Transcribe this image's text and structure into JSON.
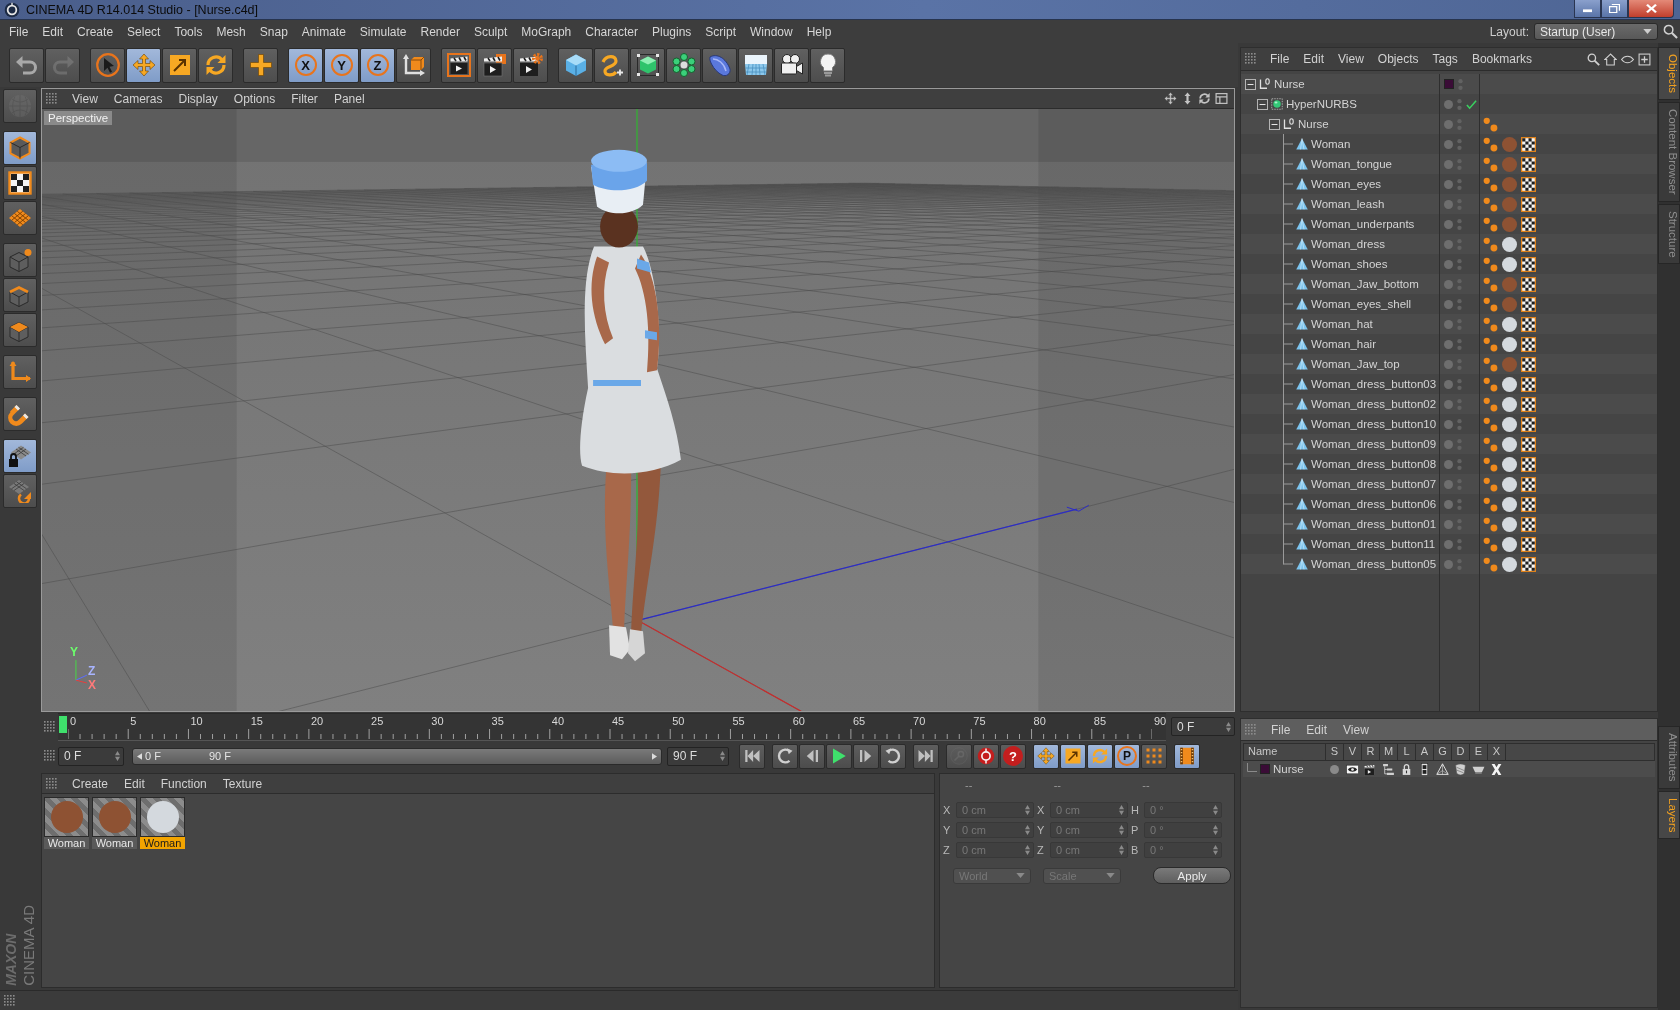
{
  "window": {
    "title": "CINEMA 4D R14.014 Studio - [Nurse.c4d]"
  },
  "menu": [
    "File",
    "Edit",
    "Create",
    "Select",
    "Tools",
    "Mesh",
    "Snap",
    "Animate",
    "Simulate",
    "Render",
    "Sculpt",
    "MoGraph",
    "Character",
    "Plugins",
    "Script",
    "Window",
    "Help"
  ],
  "layout": {
    "label": "Layout:",
    "value": "Startup (User)"
  },
  "toolbar": [
    [
      {
        "kind": "undo",
        "selected": false,
        "disabled": false
      },
      {
        "kind": "redo",
        "selected": false,
        "disabled": true
      }
    ],
    [
      {
        "kind": "live_select",
        "selected": false,
        "disabled": false
      },
      {
        "kind": "move",
        "selected": true,
        "disabled": false
      },
      {
        "kind": "scale",
        "selected": false,
        "disabled": false
      },
      {
        "kind": "rotate",
        "selected": false,
        "disabled": false
      }
    ],
    [
      {
        "kind": "add",
        "selected": false,
        "disabled": false
      }
    ],
    [
      {
        "kind": "axis_lock",
        "label": "X",
        "selected": true,
        "disabled": false
      },
      {
        "kind": "axis_lock",
        "label": "Y",
        "selected": true,
        "disabled": false
      },
      {
        "kind": "axis_lock",
        "label": "Z",
        "selected": true,
        "disabled": false
      },
      {
        "kind": "coords",
        "selected": false,
        "disabled": false
      }
    ],
    [
      {
        "kind": "render_view",
        "selected": false,
        "disabled": false
      },
      {
        "kind": "render_picture",
        "selected": false,
        "disabled": false
      },
      {
        "kind": "render_settings",
        "selected": false,
        "disabled": false
      }
    ],
    [
      {
        "kind": "cube",
        "selected": false,
        "disabled": false
      },
      {
        "kind": "spline",
        "selected": false,
        "disabled": false
      },
      {
        "kind": "nurbs",
        "selected": false,
        "disabled": false
      },
      {
        "kind": "array",
        "selected": false,
        "disabled": false
      },
      {
        "kind": "deformer",
        "selected": false,
        "disabled": false
      },
      {
        "kind": "floor",
        "selected": false,
        "disabled": false
      },
      {
        "kind": "camera",
        "selected": false,
        "disabled": false
      },
      {
        "kind": "light",
        "selected": false,
        "disabled": false
      }
    ]
  ],
  "modes": [
    [
      {
        "kind": "editable",
        "selected": false,
        "disabled": true
      }
    ],
    [
      {
        "kind": "model",
        "selected": true,
        "disabled": false
      },
      {
        "kind": "texture",
        "selected": false,
        "disabled": false
      },
      {
        "kind": "workplane",
        "selected": false,
        "disabled": false
      }
    ],
    [
      {
        "kind": "points",
        "selected": false,
        "disabled": false
      },
      {
        "kind": "edges",
        "selected": false,
        "disabled": false
      },
      {
        "kind": "polygons",
        "selected": false,
        "disabled": false
      }
    ],
    [
      {
        "kind": "axis",
        "selected": false,
        "disabled": false
      }
    ],
    [
      {
        "kind": "snap",
        "selected": false,
        "disabled": false
      }
    ],
    [
      {
        "kind": "lock",
        "selected": true,
        "disabled": false
      },
      {
        "kind": "workplane_snap",
        "selected": false,
        "disabled": false
      }
    ]
  ],
  "logo": {
    "brand": "MAXON",
    "product": "CINEMA 4D"
  },
  "viewport": {
    "menu": [
      "View",
      "Cameras",
      "Display",
      "Options",
      "Filter",
      "Panel"
    ],
    "camera": "Perspective",
    "gizmo": [
      {
        "kind": "y",
        "label": "Y"
      },
      {
        "kind": "z",
        "label": "Z"
      },
      {
        "kind": "x",
        "label": "X"
      }
    ]
  },
  "timeline": {
    "ticks": [
      "0",
      "5",
      "10",
      "15",
      "20",
      "25",
      "30",
      "35",
      "40",
      "45",
      "50",
      "55",
      "60",
      "65",
      "70",
      "75",
      "80",
      "85",
      "90"
    ],
    "level": 0,
    "frame": "0 F"
  },
  "transport": {
    "start": "0 F",
    "range": {
      "start": "0 F",
      "end": "90 F"
    },
    "end": "90 F",
    "playback": [
      [
        {
          "kind": "to_start"
        }
      ],
      [
        {
          "kind": "prev_key"
        },
        {
          "kind": "prev_frame"
        },
        {
          "kind": "play"
        },
        {
          "kind": "next_frame"
        },
        {
          "kind": "next_key"
        }
      ],
      [
        {
          "kind": "to_end"
        }
      ]
    ],
    "record": [
      {
        "kind": "key",
        "disabled": true
      },
      {
        "kind": "record",
        "disabled": false
      },
      {
        "kind": "key_help",
        "label": "?",
        "disabled": false
      }
    ],
    "keys": [
      {
        "kind": "move",
        "selected": true
      },
      {
        "kind": "scale",
        "selected": true
      },
      {
        "kind": "rotate",
        "selected": true
      },
      {
        "kind": "param",
        "label": "P",
        "selected": true
      },
      {
        "kind": "dots",
        "selected": false
      }
    ],
    "timeline_view": {
      "selected": true
    }
  },
  "materials": {
    "menu": [
      "Create",
      "Edit",
      "Function",
      "Texture"
    ],
    "items": [
      {
        "name": "Woman",
        "color": "#8e5233",
        "selected": false
      },
      {
        "name": "Woman",
        "color": "#8e5233",
        "selected": false
      },
      {
        "name": "Woman",
        "color": "#d4d9de",
        "selected": true
      }
    ]
  },
  "coordinates": {
    "disabled": true,
    "headers": [
      "--",
      "--",
      "--"
    ],
    "rows": [
      {
        "axis": "X",
        "position": "0 cm",
        "size_axis": "X",
        "size": "0 cm",
        "angle_axis": "H",
        "rotation": "0 °"
      },
      {
        "axis": "Y",
        "position": "0 cm",
        "size_axis": "Y",
        "size": "0 cm",
        "angle_axis": "P",
        "rotation": "0 °"
      },
      {
        "axis": "Z",
        "position": "0 cm",
        "size_axis": "Z",
        "size": "0 cm",
        "angle_axis": "B",
        "rotation": "0 °"
      }
    ],
    "system": "World",
    "mode": "Scale",
    "apply": "Apply"
  },
  "objects": {
    "menu": [
      "File",
      "Edit",
      "View",
      "Objects",
      "Tags",
      "Bookmarks"
    ],
    "tree": [
      {
        "name": "Nurse",
        "kind": "null",
        "expanded": true,
        "color": "#3a0c36",
        "children": [
          {
            "name": "HyperNURBS",
            "kind": "hypernurbs",
            "expanded": true,
            "enabled": true,
            "children": [
              {
                "name": "Nurse",
                "kind": "null",
                "expanded": true,
                "tags": [
                  {
                    "kind": "phong"
                  }
                ],
                "children": [
                  {
                    "name": "Woman",
                    "kind": "polygon",
                    "tags": [
                      {
                        "kind": "phong"
                      },
                      {
                        "kind": "material",
                        "color": "#8e5233"
                      },
                      {
                        "kind": "uvw"
                      }
                    ]
                  },
                  {
                    "name": "Woman_tongue",
                    "kind": "polygon",
                    "tags": [
                      {
                        "kind": "phong"
                      },
                      {
                        "kind": "material",
                        "color": "#8e5233"
                      },
                      {
                        "kind": "uvw"
                      }
                    ]
                  },
                  {
                    "name": "Woman_eyes",
                    "kind": "polygon",
                    "tags": [
                      {
                        "kind": "phong"
                      },
                      {
                        "kind": "material",
                        "color": "#8e5233"
                      },
                      {
                        "kind": "uvw"
                      }
                    ]
                  },
                  {
                    "name": "Woman_leash",
                    "kind": "polygon",
                    "tags": [
                      {
                        "kind": "phong"
                      },
                      {
                        "kind": "material",
                        "color": "#8e5233"
                      },
                      {
                        "kind": "uvw"
                      }
                    ]
                  },
                  {
                    "name": "Woman_underpants",
                    "kind": "polygon",
                    "tags": [
                      {
                        "kind": "phong"
                      },
                      {
                        "kind": "material",
                        "color": "#8e5233"
                      },
                      {
                        "kind": "uvw"
                      }
                    ]
                  },
                  {
                    "name": "Woman_dress",
                    "kind": "polygon",
                    "tags": [
                      {
                        "kind": "phong"
                      },
                      {
                        "kind": "material",
                        "color": "#d4d9de"
                      },
                      {
                        "kind": "uvw"
                      }
                    ]
                  },
                  {
                    "name": "Woman_shoes",
                    "kind": "polygon",
                    "tags": [
                      {
                        "kind": "phong"
                      },
                      {
                        "kind": "material",
                        "color": "#d4d9de"
                      },
                      {
                        "kind": "uvw"
                      }
                    ]
                  },
                  {
                    "name": "Woman_Jaw_bottom",
                    "kind": "polygon",
                    "tags": [
                      {
                        "kind": "phong"
                      },
                      {
                        "kind": "material",
                        "color": "#8e5233"
                      },
                      {
                        "kind": "uvw"
                      }
                    ]
                  },
                  {
                    "name": "Woman_eyes_shell",
                    "kind": "polygon",
                    "tags": [
                      {
                        "kind": "phong"
                      },
                      {
                        "kind": "material",
                        "color": "#8e5233"
                      },
                      {
                        "kind": "uvw"
                      }
                    ]
                  },
                  {
                    "name": "Woman_hat",
                    "kind": "polygon",
                    "tags": [
                      {
                        "kind": "phong"
                      },
                      {
                        "kind": "material",
                        "color": "#d4d9de"
                      },
                      {
                        "kind": "uvw"
                      }
                    ]
                  },
                  {
                    "name": "Woman_hair",
                    "kind": "polygon",
                    "tags": [
                      {
                        "kind": "phong"
                      },
                      {
                        "kind": "material",
                        "color": "#d4d9de"
                      },
                      {
                        "kind": "uvw"
                      }
                    ]
                  },
                  {
                    "name": "Woman_Jaw_top",
                    "kind": "polygon",
                    "tags": [
                      {
                        "kind": "phong"
                      },
                      {
                        "kind": "material",
                        "color": "#8e5233"
                      },
                      {
                        "kind": "uvw"
                      }
                    ]
                  },
                  {
                    "name": "Woman_dress_button03",
                    "kind": "polygon",
                    "tags": [
                      {
                        "kind": "phong"
                      },
                      {
                        "kind": "material",
                        "color": "#d4d9de"
                      },
                      {
                        "kind": "uvw"
                      }
                    ]
                  },
                  {
                    "name": "Woman_dress_button02",
                    "kind": "polygon",
                    "tags": [
                      {
                        "kind": "phong"
                      },
                      {
                        "kind": "material",
                        "color": "#d4d9de"
                      },
                      {
                        "kind": "uvw"
                      }
                    ]
                  },
                  {
                    "name": "Woman_dress_button10",
                    "kind": "polygon",
                    "tags": [
                      {
                        "kind": "phong"
                      },
                      {
                        "kind": "material",
                        "color": "#d4d9de"
                      },
                      {
                        "kind": "uvw"
                      }
                    ]
                  },
                  {
                    "name": "Woman_dress_button09",
                    "kind": "polygon",
                    "tags": [
                      {
                        "kind": "phong"
                      },
                      {
                        "kind": "material",
                        "color": "#d4d9de"
                      },
                      {
                        "kind": "uvw"
                      }
                    ]
                  },
                  {
                    "name": "Woman_dress_button08",
                    "kind": "polygon",
                    "tags": [
                      {
                        "kind": "phong"
                      },
                      {
                        "kind": "material",
                        "color": "#d4d9de"
                      },
                      {
                        "kind": "uvw"
                      }
                    ]
                  },
                  {
                    "name": "Woman_dress_button07",
                    "kind": "polygon",
                    "tags": [
                      {
                        "kind": "phong"
                      },
                      {
                        "kind": "material",
                        "color": "#d4d9de"
                      },
                      {
                        "kind": "uvw"
                      }
                    ]
                  },
                  {
                    "name": "Woman_dress_button06",
                    "kind": "polygon",
                    "tags": [
                      {
                        "kind": "phong"
                      },
                      {
                        "kind": "material",
                        "color": "#d4d9de"
                      },
                      {
                        "kind": "uvw"
                      }
                    ]
                  },
                  {
                    "name": "Woman_dress_button01",
                    "kind": "polygon",
                    "tags": [
                      {
                        "kind": "phong"
                      },
                      {
                        "kind": "material",
                        "color": "#d4d9de"
                      },
                      {
                        "kind": "uvw"
                      }
                    ]
                  },
                  {
                    "name": "Woman_dress_button11",
                    "kind": "polygon",
                    "tags": [
                      {
                        "kind": "phong"
                      },
                      {
                        "kind": "material",
                        "color": "#d4d9de"
                      },
                      {
                        "kind": "uvw"
                      }
                    ]
                  },
                  {
                    "name": "Woman_dress_button05",
                    "kind": "polygon",
                    "tags": [
                      {
                        "kind": "phong"
                      },
                      {
                        "kind": "material",
                        "color": "#d4d9de"
                      },
                      {
                        "kind": "uvw"
                      }
                    ]
                  }
                ]
              }
            ]
          }
        ]
      }
    ]
  },
  "layers": {
    "menu": [
      "File",
      "Edit",
      "View"
    ],
    "columns": [
      "Name",
      "S",
      "V",
      "R",
      "M",
      "L",
      "A",
      "G",
      "D",
      "E",
      "X"
    ],
    "rows": [
      {
        "name": "Nurse",
        "color": "#3a0c36",
        "solo": false
      }
    ]
  },
  "side_tabs": [
    {
      "label": "Objects",
      "selected": true
    },
    {
      "label": "Content Browser",
      "selected": false
    },
    {
      "label": "Structure",
      "selected": false
    }
  ],
  "side_tabs_lower": [
    {
      "label": "Attributes",
      "selected": false
    },
    {
      "label": "Layers",
      "selected": true
    }
  ]
}
